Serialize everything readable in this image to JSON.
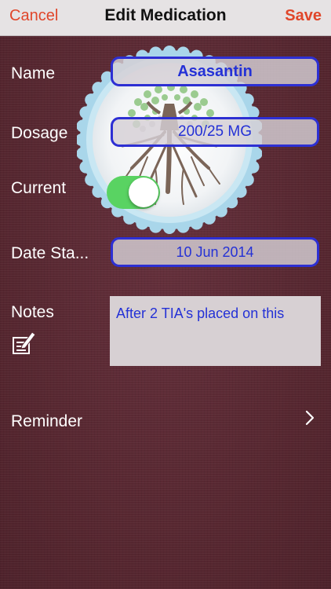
{
  "navbar": {
    "cancel_label": "Cancel",
    "title": "Edit Medication",
    "save_label": "Save"
  },
  "form": {
    "name_label": "Name",
    "name_value": "Asasantin",
    "dosage_label": "Dosage",
    "dosage_value": "200/25 MG",
    "current_label": "Current",
    "current_on": true,
    "date_label": "Date Sta...",
    "date_value": "10 Jun 2014",
    "notes_label": "Notes",
    "notes_value": "After 2 TIA's placed on this",
    "reminder_label": "Reminder"
  },
  "icons": {
    "logo": "tree-logo-icon",
    "notes": "edit-note-icon",
    "reminder": "chevron-right-icon"
  },
  "colors": {
    "accent": "#e0462a",
    "field_text": "#2431d6",
    "field_border": "#2d2fd3",
    "toggle_on": "#59d362",
    "background": "#5a2a35"
  }
}
